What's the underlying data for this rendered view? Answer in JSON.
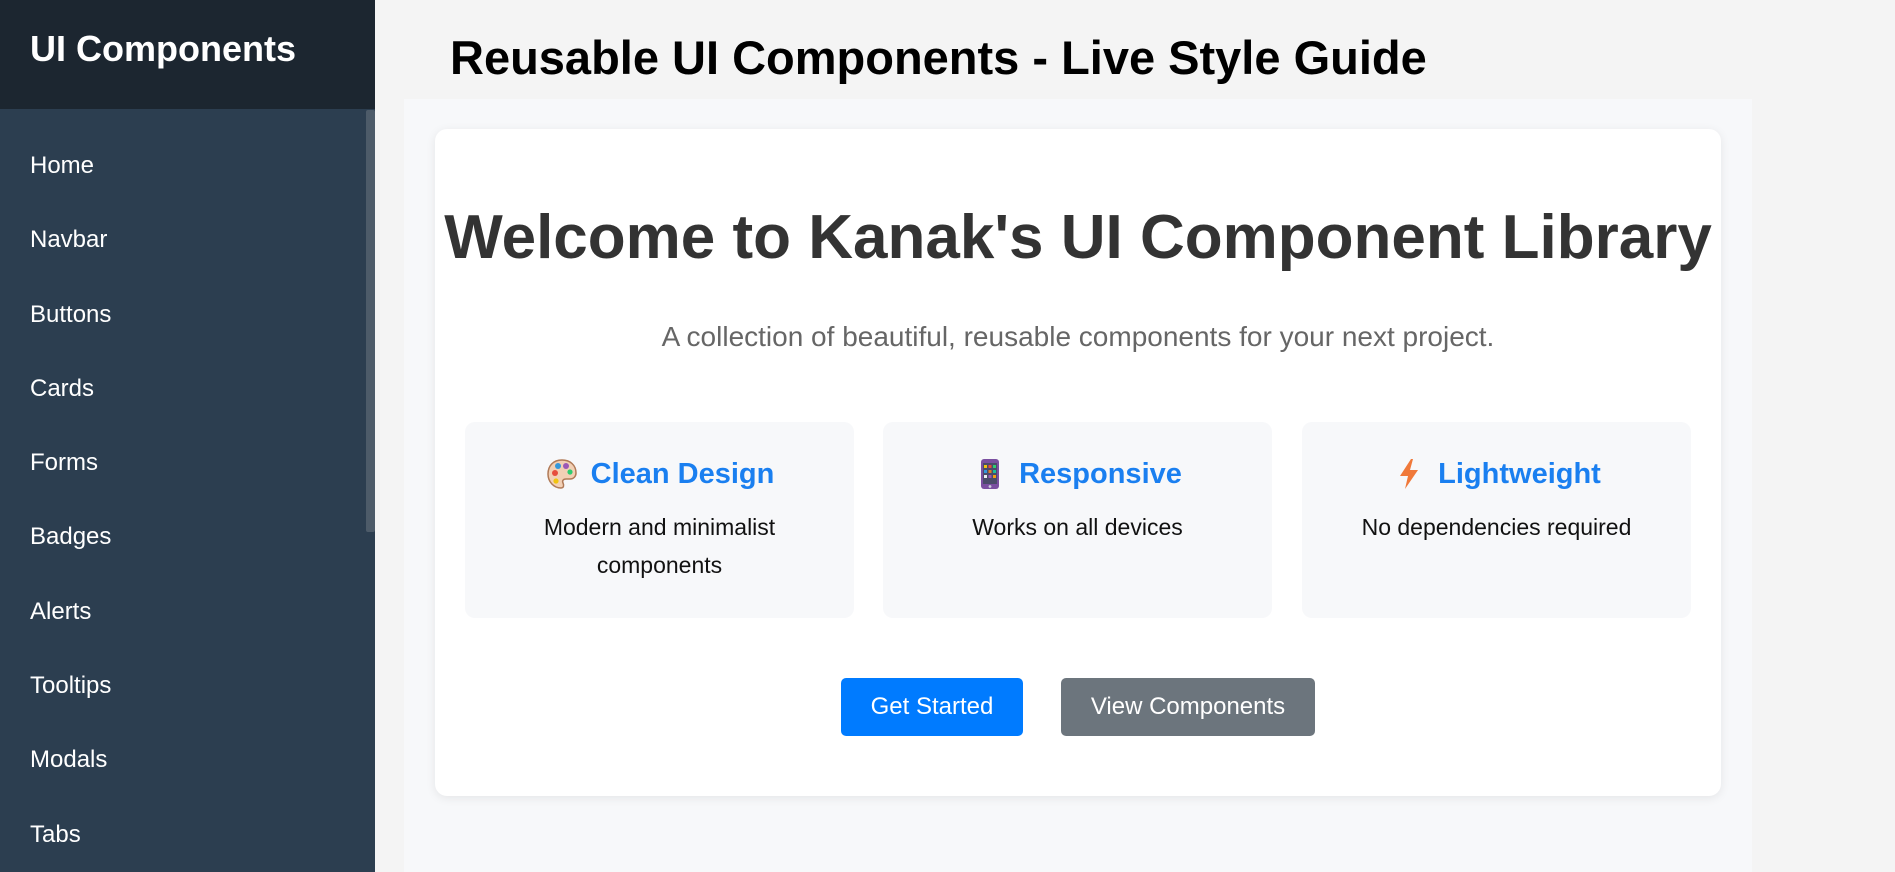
{
  "sidebar": {
    "title": "UI Components",
    "items": [
      {
        "label": "Home"
      },
      {
        "label": "Navbar"
      },
      {
        "label": "Buttons"
      },
      {
        "label": "Cards"
      },
      {
        "label": "Forms"
      },
      {
        "label": "Badges"
      },
      {
        "label": "Alerts"
      },
      {
        "label": "Tooltips"
      },
      {
        "label": "Modals"
      },
      {
        "label": "Tabs"
      }
    ]
  },
  "header": {
    "title": "Reusable UI Components - Live Style Guide"
  },
  "hero": {
    "title": "Welcome to Kanak's UI Component Library",
    "subtitle": "A collection of beautiful, reusable components for your next project.",
    "features": [
      {
        "icon": "palette-icon",
        "title": "Clean Design",
        "description": "Modern and minimalist components"
      },
      {
        "icon": "mobile-phone-icon",
        "title": "Responsive",
        "description": "Works on all devices"
      },
      {
        "icon": "lightning-icon",
        "title": "Lightweight",
        "description": "No dependencies required"
      }
    ],
    "buttons": {
      "primary_label": "Get Started",
      "secondary_label": "View Components"
    }
  },
  "colors": {
    "sidebar_bg": "#2c3e50",
    "sidebar_header_bg": "#1c2630",
    "accent": "#1a7ff0",
    "primary_button": "#007bff",
    "secondary_button": "#6c757d"
  }
}
